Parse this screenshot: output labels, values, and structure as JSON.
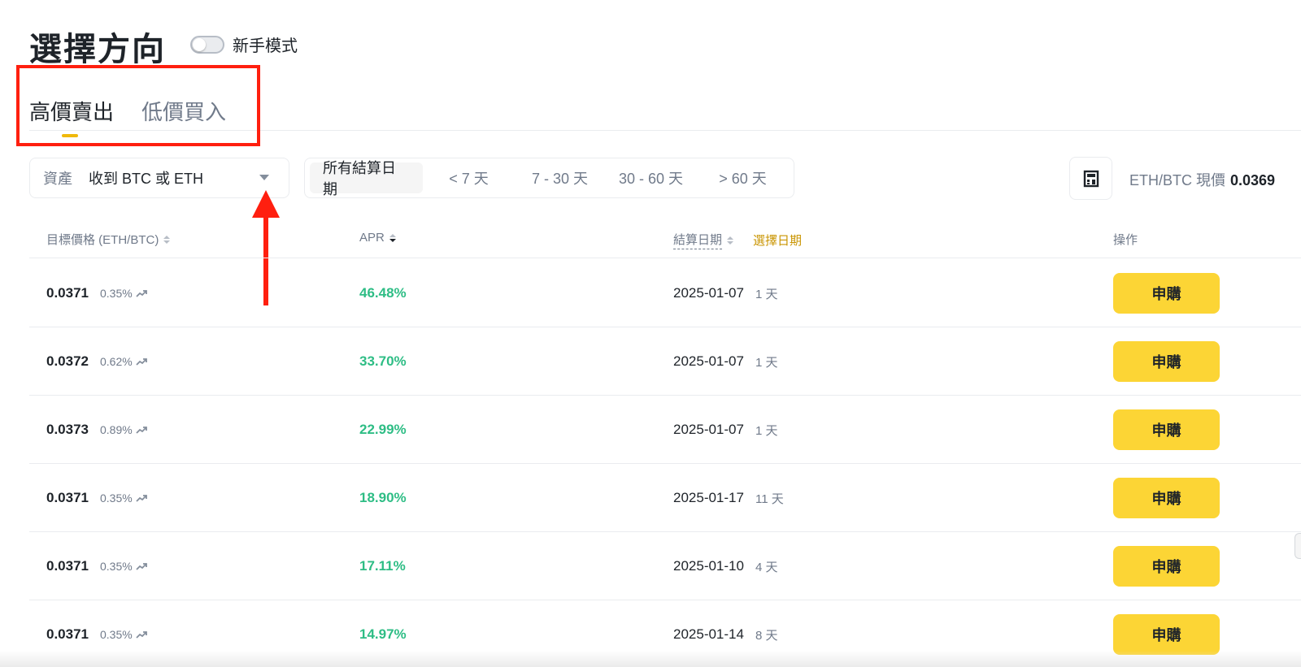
{
  "header": {
    "title": "選擇方向",
    "beginner_mode_label": "新手模式",
    "beginner_mode_on": false
  },
  "tabs": [
    {
      "label": "高價賣出",
      "active": true
    },
    {
      "label": "低價買入",
      "active": false
    }
  ],
  "filters": {
    "asset_label": "資產",
    "asset_value": "收到 BTC 或 ETH",
    "periods": [
      "所有結算日期",
      "< 7 天",
      "7 - 30 天",
      "30 - 60 天",
      "> 60 天"
    ],
    "active_period": "所有結算日期"
  },
  "price_info": {
    "label": "ETH/BTC 現價",
    "value": "0.0369"
  },
  "table": {
    "headers": {
      "target_price": "目標價格 (ETH/BTC)",
      "apr": "APR",
      "settle_date": "結算日期",
      "select_date": "選擇日期",
      "action": "操作"
    },
    "subscribe_label": "申購",
    "rows": [
      {
        "price": "0.0371",
        "pct": "0.35%",
        "apr": "46.48%",
        "date": "2025-01-07",
        "days": "1 天"
      },
      {
        "price": "0.0372",
        "pct": "0.62%",
        "apr": "33.70%",
        "date": "2025-01-07",
        "days": "1 天"
      },
      {
        "price": "0.0373",
        "pct": "0.89%",
        "apr": "22.99%",
        "date": "2025-01-07",
        "days": "1 天"
      },
      {
        "price": "0.0371",
        "pct": "0.35%",
        "apr": "18.90%",
        "date": "2025-01-17",
        "days": "11 天"
      },
      {
        "price": "0.0371",
        "pct": "0.35%",
        "apr": "17.11%",
        "date": "2025-01-10",
        "days": "4 天"
      },
      {
        "price": "0.0371",
        "pct": "0.35%",
        "apr": "14.97%",
        "date": "2025-01-14",
        "days": "8 天"
      }
    ]
  },
  "colors": {
    "accent": "#fcd535",
    "positive": "#2ebd85",
    "highlight": "#ff1f0f",
    "select_date": "#c99400"
  },
  "icons": {
    "calculator": "calculator-icon",
    "trend": "trend-up-icon",
    "caret": "caret-down-icon"
  }
}
